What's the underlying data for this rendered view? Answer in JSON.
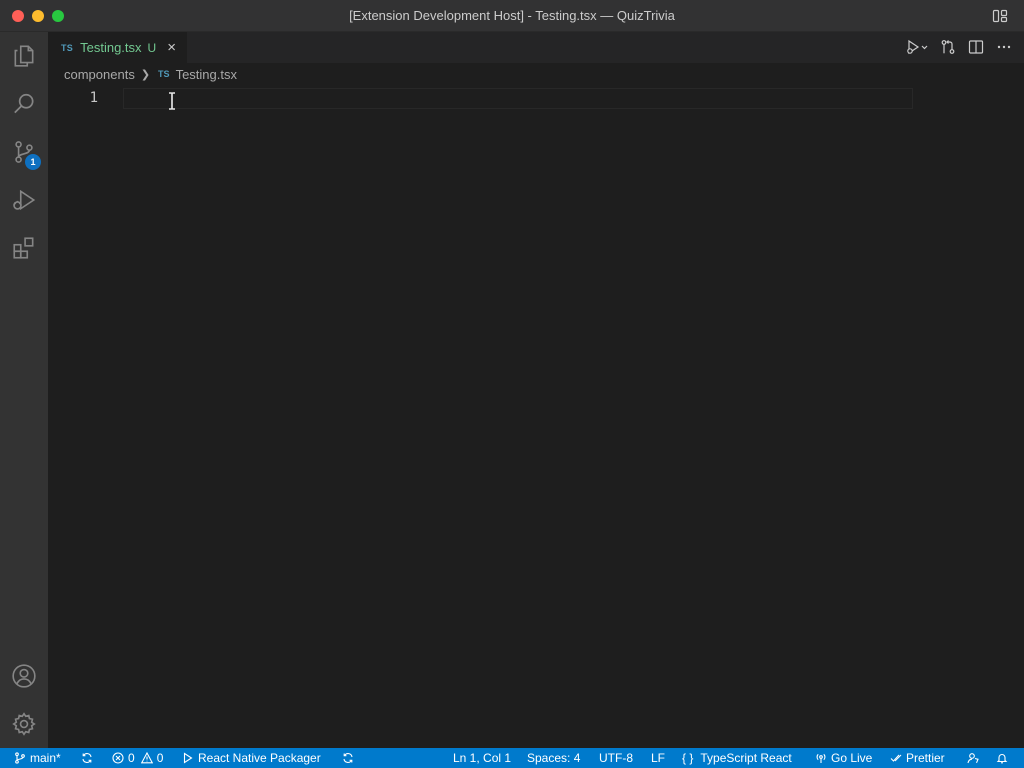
{
  "window": {
    "title": "[Extension Development Host] - Testing.tsx — QuizTrivia"
  },
  "activity_bar": {
    "items": [
      {
        "name": "explorer-icon"
      },
      {
        "name": "search-icon"
      },
      {
        "name": "source-control-icon",
        "badge": "1"
      },
      {
        "name": "run-debug-icon"
      },
      {
        "name": "extensions-icon"
      }
    ],
    "bottom_items": [
      {
        "name": "accounts-icon"
      },
      {
        "name": "manage-gear-icon"
      }
    ]
  },
  "tabs": [
    {
      "lang_badge": "TS",
      "label": "Testing.tsx",
      "status": "U",
      "active": true
    }
  ],
  "breadcrumb": {
    "folder": "components",
    "file_badge": "TS",
    "file": "Testing.tsx"
  },
  "editor": {
    "line_numbers": [
      "1"
    ],
    "content": ""
  },
  "statusbar": {
    "branch": "main*",
    "errors": "0",
    "warnings": "0",
    "packager": "React Native Packager",
    "cursor": "Ln 1, Col 1",
    "spaces": "Spaces: 4",
    "encoding": "UTF-8",
    "eol": "LF",
    "language": "TypeScript React",
    "go_live": "Go Live",
    "prettier": "Prettier"
  },
  "colors": {
    "statusbar_bg": "#007acc",
    "activitybar_bg": "#333333",
    "editor_bg": "#1e1e1e",
    "untracked_green": "#73c991",
    "ts_blue": "#519aba",
    "badge_blue": "#0e70c0"
  }
}
